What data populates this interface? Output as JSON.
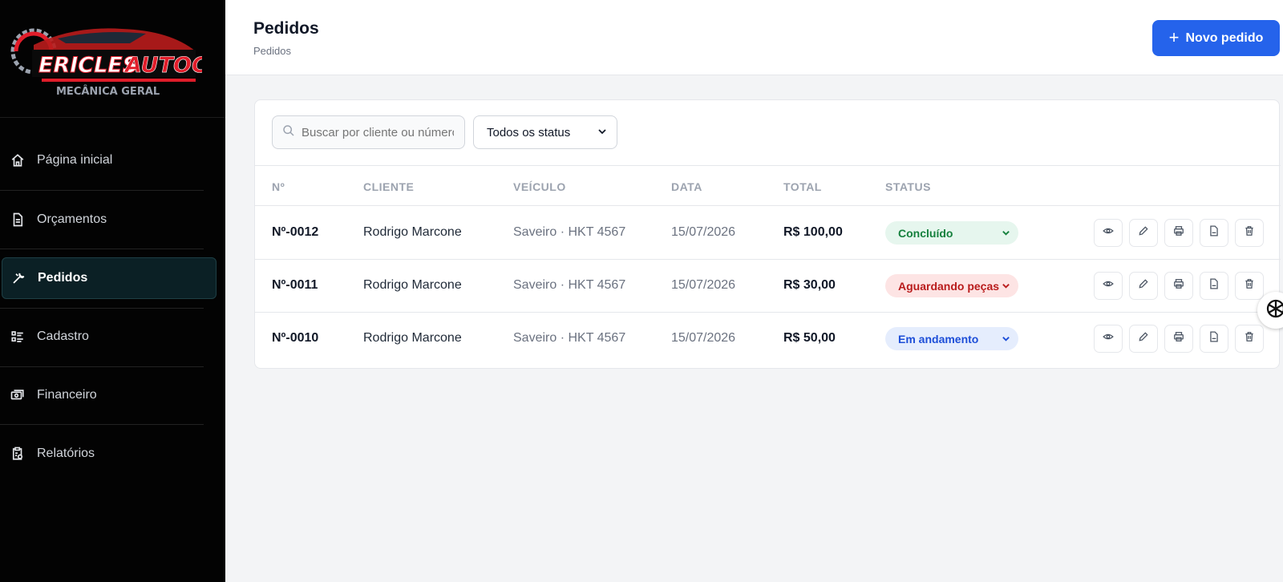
{
  "sidebar": {
    "logo": {
      "brand": "ERICLES AUTOCAR",
      "tagline": "MECÂNICA GERAL"
    },
    "items": [
      {
        "label": "Página inicial",
        "icon": "home-icon"
      },
      {
        "label": "Orçamentos",
        "icon": "document-icon"
      },
      {
        "label": "Pedidos",
        "icon": "wrench-icon",
        "active": true
      },
      {
        "label": "Cadastro",
        "icon": "list-icon"
      },
      {
        "label": "Financeiro",
        "icon": "money-icon"
      },
      {
        "label": "Relatórios",
        "icon": "report-icon"
      }
    ]
  },
  "header": {
    "title": "Pedidos",
    "breadcrumb": "Pedidos",
    "new_button": "Novo pedido"
  },
  "filters": {
    "search_placeholder": "Buscar por cliente ou número",
    "status_value": "Todos os status"
  },
  "table": {
    "columns": [
      "Nº",
      "CLIENTE",
      "VEÍCULO",
      "DATA",
      "TOTAL",
      "STATUS"
    ],
    "rows": [
      {
        "num": "Nº-0012",
        "client": "Rodrigo Marcone",
        "vehicle": "Saveiro · HKT 4567",
        "date": "15/07/2026",
        "total": "R$ 100,00",
        "status": "Concluído",
        "status_color": "#15803d"
      },
      {
        "num": "Nº-0011",
        "client": "Rodrigo Marcone",
        "vehicle": "Saveiro · HKT 4567",
        "date": "15/07/2026",
        "total": "R$ 30,00",
        "status": "Aguardando peças",
        "status_color": "#b91c1c"
      },
      {
        "num": "Nº-0010",
        "client": "Rodrigo Marcone",
        "vehicle": "Saveiro · HKT 4567",
        "date": "15/07/2026",
        "total": "R$ 50,00",
        "status": "Em andamento",
        "status_color": "#1d4ed8"
      }
    ],
    "row_actions": [
      "eye-icon",
      "pencil-icon",
      "printer-icon",
      "pdf-icon",
      "trash-icon"
    ]
  },
  "colors": {
    "accent": "#2563eb",
    "sidebar_bg": "#030303",
    "logo_red": "#e11d2a"
  }
}
